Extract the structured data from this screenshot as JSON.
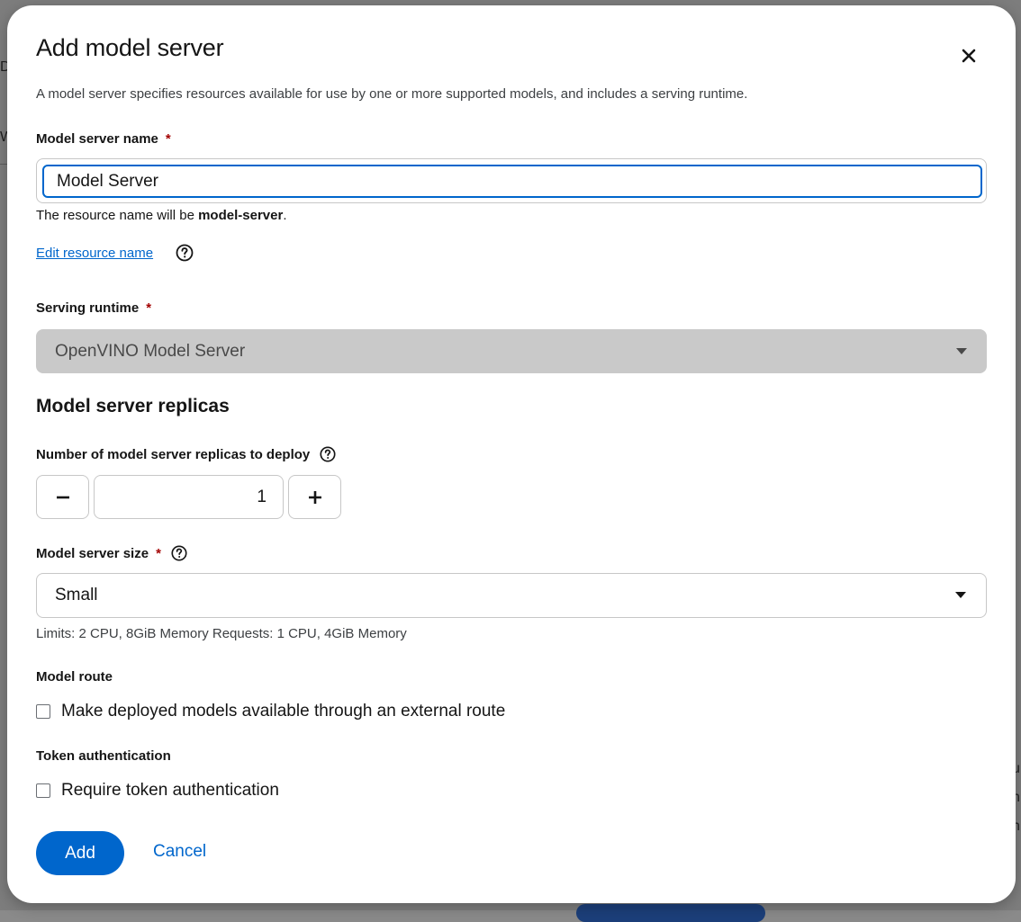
{
  "background": {
    "fragments": [
      "De",
      "W",
      "u",
      "n",
      "n"
    ]
  },
  "dialog": {
    "title": "Add model server",
    "description": "A model server specifies resources available for use by one or more supported models, and includes a serving runtime.",
    "required_marker": "*"
  },
  "server_name": {
    "label": "Model server name",
    "value": "Model Server",
    "helper_prefix": "The resource name will be ",
    "resource_name": "model-server",
    "helper_suffix": ".",
    "edit_link": "Edit resource name"
  },
  "serving_runtime": {
    "label": "Serving runtime",
    "selected": "OpenVINO Model Server"
  },
  "replicas": {
    "section_title": "Model server replicas",
    "label": "Number of model server replicas to deploy",
    "value": "1"
  },
  "server_size": {
    "label": "Model server size",
    "selected": "Small",
    "hint": "Limits: 2 CPU, 8GiB Memory Requests: 1 CPU, 4GiB Memory"
  },
  "model_route": {
    "label": "Model route",
    "checkbox_label": "Make deployed models available through an external route",
    "checked": false
  },
  "token_auth": {
    "label": "Token authentication",
    "checkbox_label": "Require token authentication",
    "checked": false
  },
  "actions": {
    "add_label": "Add",
    "cancel_label": "Cancel"
  },
  "colors": {
    "primary": "#0066cc",
    "required": "#a30000",
    "disabled_bg": "#c9c9c9"
  }
}
